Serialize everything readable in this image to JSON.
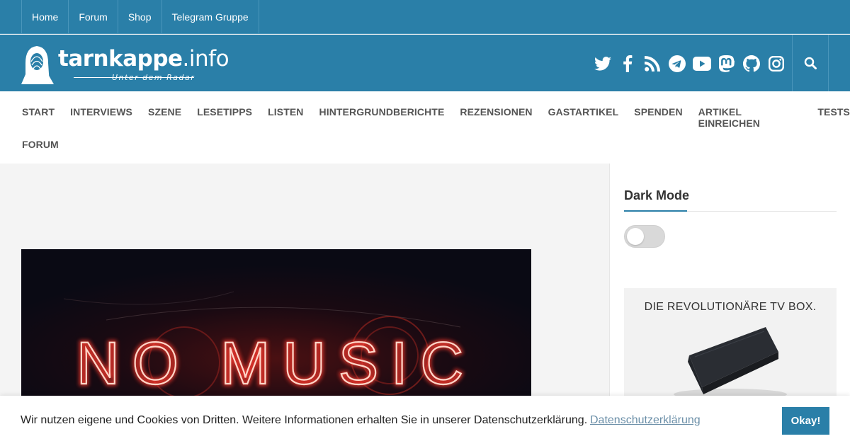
{
  "topbar": {
    "links": [
      "Home",
      "Forum",
      "Shop",
      "Telegram Gruppe"
    ]
  },
  "logo": {
    "brand_main": "tarnkappe",
    "brand_tld": ".info",
    "tagline": "Unter dem Radar"
  },
  "social_icons": [
    "twitter-icon",
    "facebook-icon",
    "rss-icon",
    "telegram-icon",
    "youtube-icon",
    "mastodon-icon",
    "github-icon",
    "instagram-icon"
  ],
  "main_nav": {
    "row1": [
      "Start",
      "Interviews",
      "Szene",
      "Lesetipps",
      "Listen",
      "Hintergrundberichte",
      "Rezensionen",
      "Gastartikel",
      "Spenden",
      "Artikel einreichen",
      "Tests"
    ],
    "row2": [
      "Forum"
    ]
  },
  "hero": {
    "neon_text": "NO MUSIC"
  },
  "sidebar": {
    "widget_title": "Dark Mode",
    "ad_title": "DIE REVOLUTIONÄRE TV BOX."
  },
  "cookie": {
    "message": "Wir nutzen eigene und Cookies von Dritten. Weitere Informationen erhalten Sie in unserer Datenschutzerklärung.",
    "link": "Datenschutzerklärung",
    "button": "Okay!"
  },
  "colors": {
    "brand_blue": "#2a7fa8",
    "neon_red": "#ff5a4a"
  }
}
